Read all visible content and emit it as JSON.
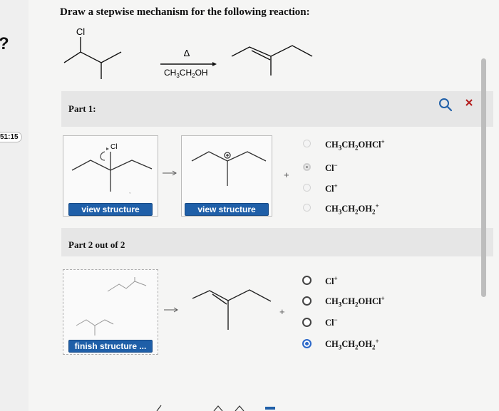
{
  "question": "Draw a stepwise mechanism for the following reaction:",
  "reaction": {
    "substituent": "Cl",
    "condition_top": "Δ",
    "condition_bottom": "CH3CH2OH"
  },
  "sidebar": {
    "timer": "51:15"
  },
  "part1": {
    "label": "Part 1:",
    "box1_atom": "Cl",
    "view_button_1": "view structure",
    "view_button_2": "view structure",
    "plus": "+",
    "options": [
      {
        "text": "CH3CH2OHCl+",
        "selected": false
      },
      {
        "text": "Cl−",
        "selected": true
      },
      {
        "text": "Cl+",
        "selected": false
      },
      {
        "text": "CH3CH2OH2+",
        "selected": false
      }
    ]
  },
  "part2": {
    "label": "Part 2 out of 2",
    "finish_button": "finish structure ...",
    "plus": "+",
    "options": [
      {
        "text": "Cl+",
        "selected": false
      },
      {
        "text": "CH3CH2OHCl+",
        "selected": false
      },
      {
        "text": "Cl−",
        "selected": false
      },
      {
        "text": "CH3CH2OH2+",
        "selected": true
      }
    ]
  },
  "toolbar": {
    "search_icon": "magnifier-icon",
    "close_icon": "close-icon"
  },
  "colors": {
    "button": "#1f5fa8",
    "radio_selected": "#2d69c9"
  }
}
